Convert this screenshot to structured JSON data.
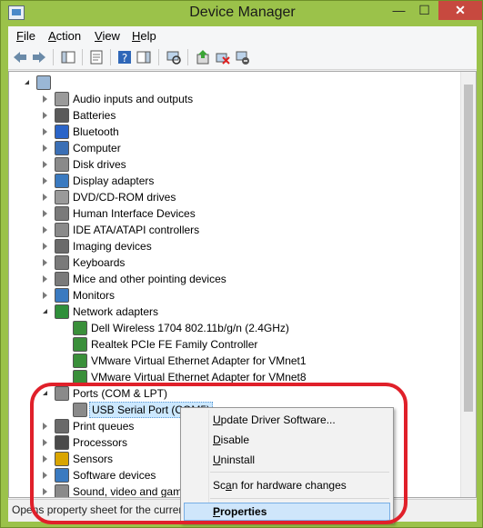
{
  "window": {
    "title": "Device Manager",
    "min_label": "—",
    "max_label": "☐",
    "close_label": "✕"
  },
  "menu": [
    {
      "label_pre": "",
      "label_key": "F",
      "label_post": "ile"
    },
    {
      "label_pre": "",
      "label_key": "A",
      "label_post": "ction"
    },
    {
      "label_pre": "",
      "label_key": "V",
      "label_post": "iew"
    },
    {
      "label_pre": "",
      "label_key": "H",
      "label_post": "elp"
    }
  ],
  "toolbar": {
    "icons": [
      "back-icon",
      "forward-icon",
      "show-hide-console-tree-icon",
      "properties-icon",
      "help-icon",
      "show-hide-action-pane-icon",
      "scan-hardware-icon",
      "update-driver-icon",
      "disable-device-icon",
      "uninstall-device-icon"
    ]
  },
  "tree": {
    "root": "",
    "categories": [
      {
        "label": "Audio inputs and outputs",
        "expanded": false
      },
      {
        "label": "Batteries",
        "expanded": false
      },
      {
        "label": "Bluetooth",
        "expanded": false
      },
      {
        "label": "Computer",
        "expanded": false
      },
      {
        "label": "Disk drives",
        "expanded": false
      },
      {
        "label": "Display adapters",
        "expanded": false
      },
      {
        "label": "DVD/CD-ROM drives",
        "expanded": false
      },
      {
        "label": "Human Interface Devices",
        "expanded": false
      },
      {
        "label": "IDE ATA/ATAPI controllers",
        "expanded": false
      },
      {
        "label": "Imaging devices",
        "expanded": false
      },
      {
        "label": "Keyboards",
        "expanded": false
      },
      {
        "label": "Mice and other pointing devices",
        "expanded": false
      },
      {
        "label": "Monitors",
        "expanded": false
      },
      {
        "label": "Network adapters",
        "expanded": true
      },
      {
        "label": "Ports (COM & LPT)",
        "expanded": true
      },
      {
        "label": "Print queues",
        "expanded": false
      },
      {
        "label": "Processors",
        "expanded": false
      },
      {
        "label": "Sensors",
        "expanded": false
      },
      {
        "label": "Software devices",
        "expanded": false
      },
      {
        "label": "Sound, video and game",
        "expanded": false
      }
    ],
    "network_children": [
      "Dell Wireless 1704 802.11b/g/n (2.4GHz)",
      "Realtek PCIe FE Family Controller",
      "VMware Virtual Ethernet Adapter for VMnet1",
      "VMware Virtual Ethernet Adapter for VMnet8"
    ],
    "ports_children": [
      "USB Serial Port (COM5)"
    ]
  },
  "context_menu": {
    "items": [
      {
        "pre": "",
        "key": "U",
        "post": "pdate Driver Software..."
      },
      {
        "pre": "",
        "key": "D",
        "post": "isable"
      },
      {
        "pre": "",
        "key": "U",
        "post": "ninstall"
      },
      {
        "pre": "Sc",
        "key": "a",
        "post": "n for hardware changes"
      },
      {
        "pre": "",
        "key": "P",
        "post": "roperties"
      }
    ]
  },
  "status": {
    "text": "Opens property sheet for the current selection."
  },
  "colors": {
    "annotation": "#e0202a",
    "frame": "#9bc24a",
    "selection": "#cce8ff"
  }
}
